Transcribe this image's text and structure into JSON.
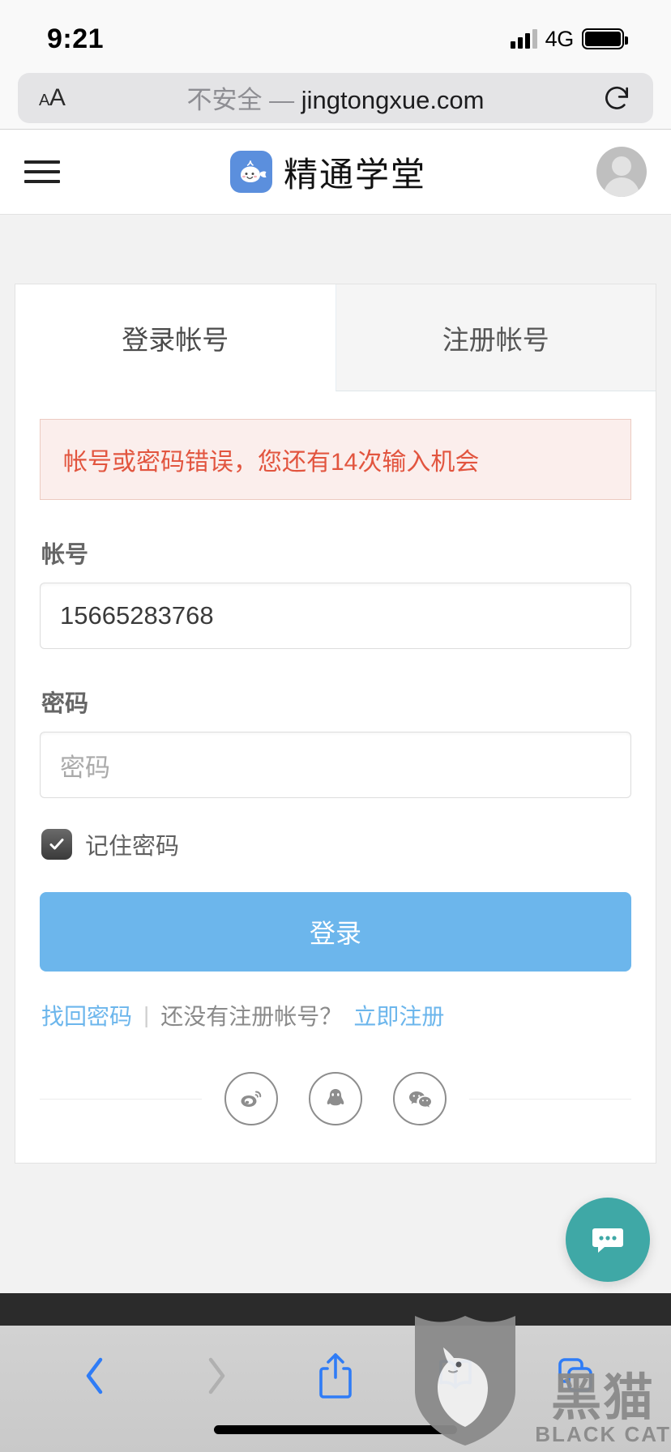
{
  "status_bar": {
    "time": "9:21",
    "network": "4G",
    "signal_icon": "cellular-signal-icon",
    "battery_icon": "battery-full-icon"
  },
  "browser": {
    "text_size_button": "AA",
    "security_label": "不安全",
    "separator": "—",
    "domain": "jingtongxue.com",
    "reload_icon": "reload-icon",
    "toolbar": {
      "back_icon": "chevron-left-icon",
      "forward_icon": "chevron-right-icon",
      "share_icon": "share-icon",
      "bookmarks_icon": "book-icon",
      "tabs_icon": "tabs-icon"
    }
  },
  "app_header": {
    "menu_icon": "hamburger-menu-icon",
    "logo_icon": "whale-logo-icon",
    "logo_color": "#5b8fdd",
    "title": "精通学堂",
    "avatar_icon": "user-avatar-icon"
  },
  "tabs": [
    {
      "label": "登录帐号",
      "active": true
    },
    {
      "label": "注册帐号",
      "active": false
    }
  ],
  "alert": {
    "message": "帐号或密码错误，您还有14次输入机会",
    "text_color": "#e2553f",
    "bg_color": "#fbeeec",
    "border_color": "#eccac1"
  },
  "form": {
    "account": {
      "label": "帐号",
      "value": "15665283768"
    },
    "password": {
      "label": "密码",
      "placeholder": "密码",
      "value": ""
    },
    "remember": {
      "label": "记住密码",
      "checked": true,
      "icon": "checkbox-checked-icon"
    },
    "submit": {
      "label": "登录",
      "color": "#6cb6ec"
    }
  },
  "links": {
    "forgot_password": "找回密码",
    "divider": "|",
    "no_account_text": "还没有注册帐号？",
    "register_now": "立即注册",
    "link_color": "#6cb6ec"
  },
  "social_login": [
    {
      "name": "weibo-icon",
      "title": "微博"
    },
    {
      "name": "qq-icon",
      "title": "QQ"
    },
    {
      "name": "wechat-icon",
      "title": "微信"
    }
  ],
  "chat_fab": {
    "icon": "chat-bubble-icon",
    "color": "#3fa8a6"
  },
  "watermark": {
    "icon": "black-cat-shield-icon",
    "cn": "黑猫",
    "en": "BLACK CAT"
  }
}
